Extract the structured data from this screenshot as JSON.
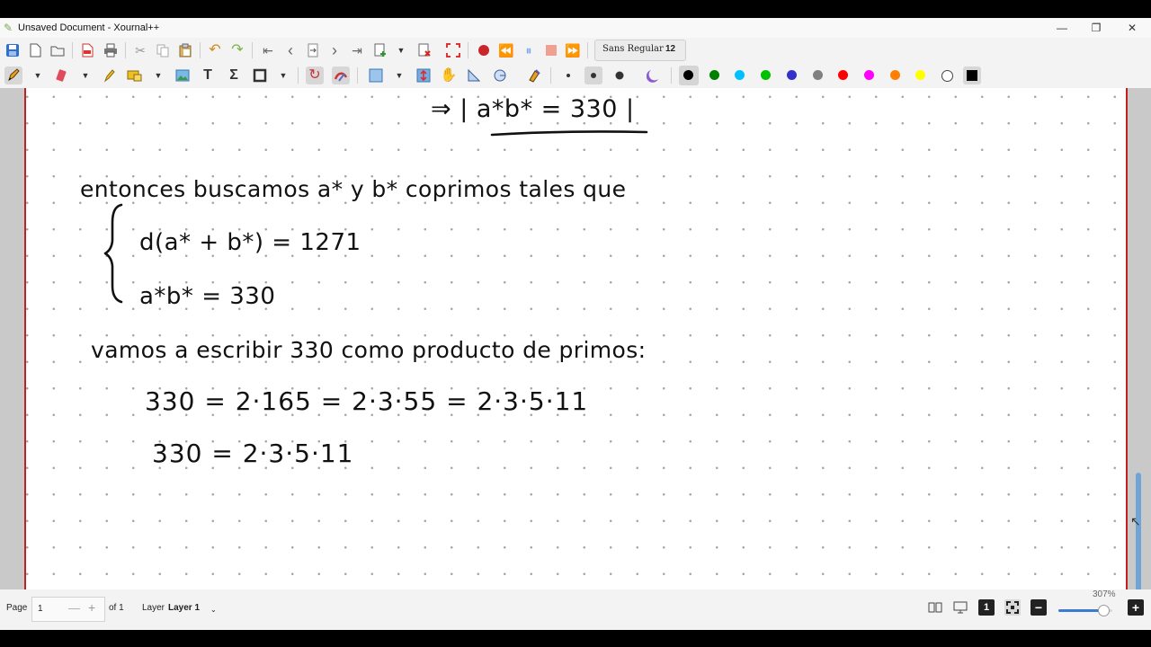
{
  "window": {
    "title": "Unsaved Document - Xournal++",
    "controls": {
      "minimize": "—",
      "maximize": "❐",
      "close": "✕"
    }
  },
  "toolbar": {
    "font_name": "Sans Regular",
    "font_size": "12",
    "colors": [
      "#000000",
      "#008000",
      "#00c0ff",
      "#00c000",
      "#3333cc",
      "#808080",
      "#ff0000",
      "#ff00ff",
      "#ff8000",
      "#ffff00",
      "#ffffff"
    ],
    "selected_color_index": 0
  },
  "note": {
    "line1": "⇒ | a*b* = 330 |",
    "line2": "entonces buscamos a* y b* coprimos tales que",
    "sys1": "d(a* + b*) = 1271",
    "sys2": "a*b* = 330",
    "line3": "vamos a escribir 330 como producto de primos:",
    "line4": "330 = 2·165 = 2·3·55 = 2·3·5·11",
    "line5": "330 = 2·3·5·11"
  },
  "status": {
    "page_label": "Page",
    "page_value": "1",
    "page_minus": "—",
    "page_plus": "+",
    "page_total": "of 1",
    "layer_label": "Layer",
    "layer_value": "Layer 1",
    "zoom_label": "307%",
    "zoom_fraction": 0.83
  }
}
